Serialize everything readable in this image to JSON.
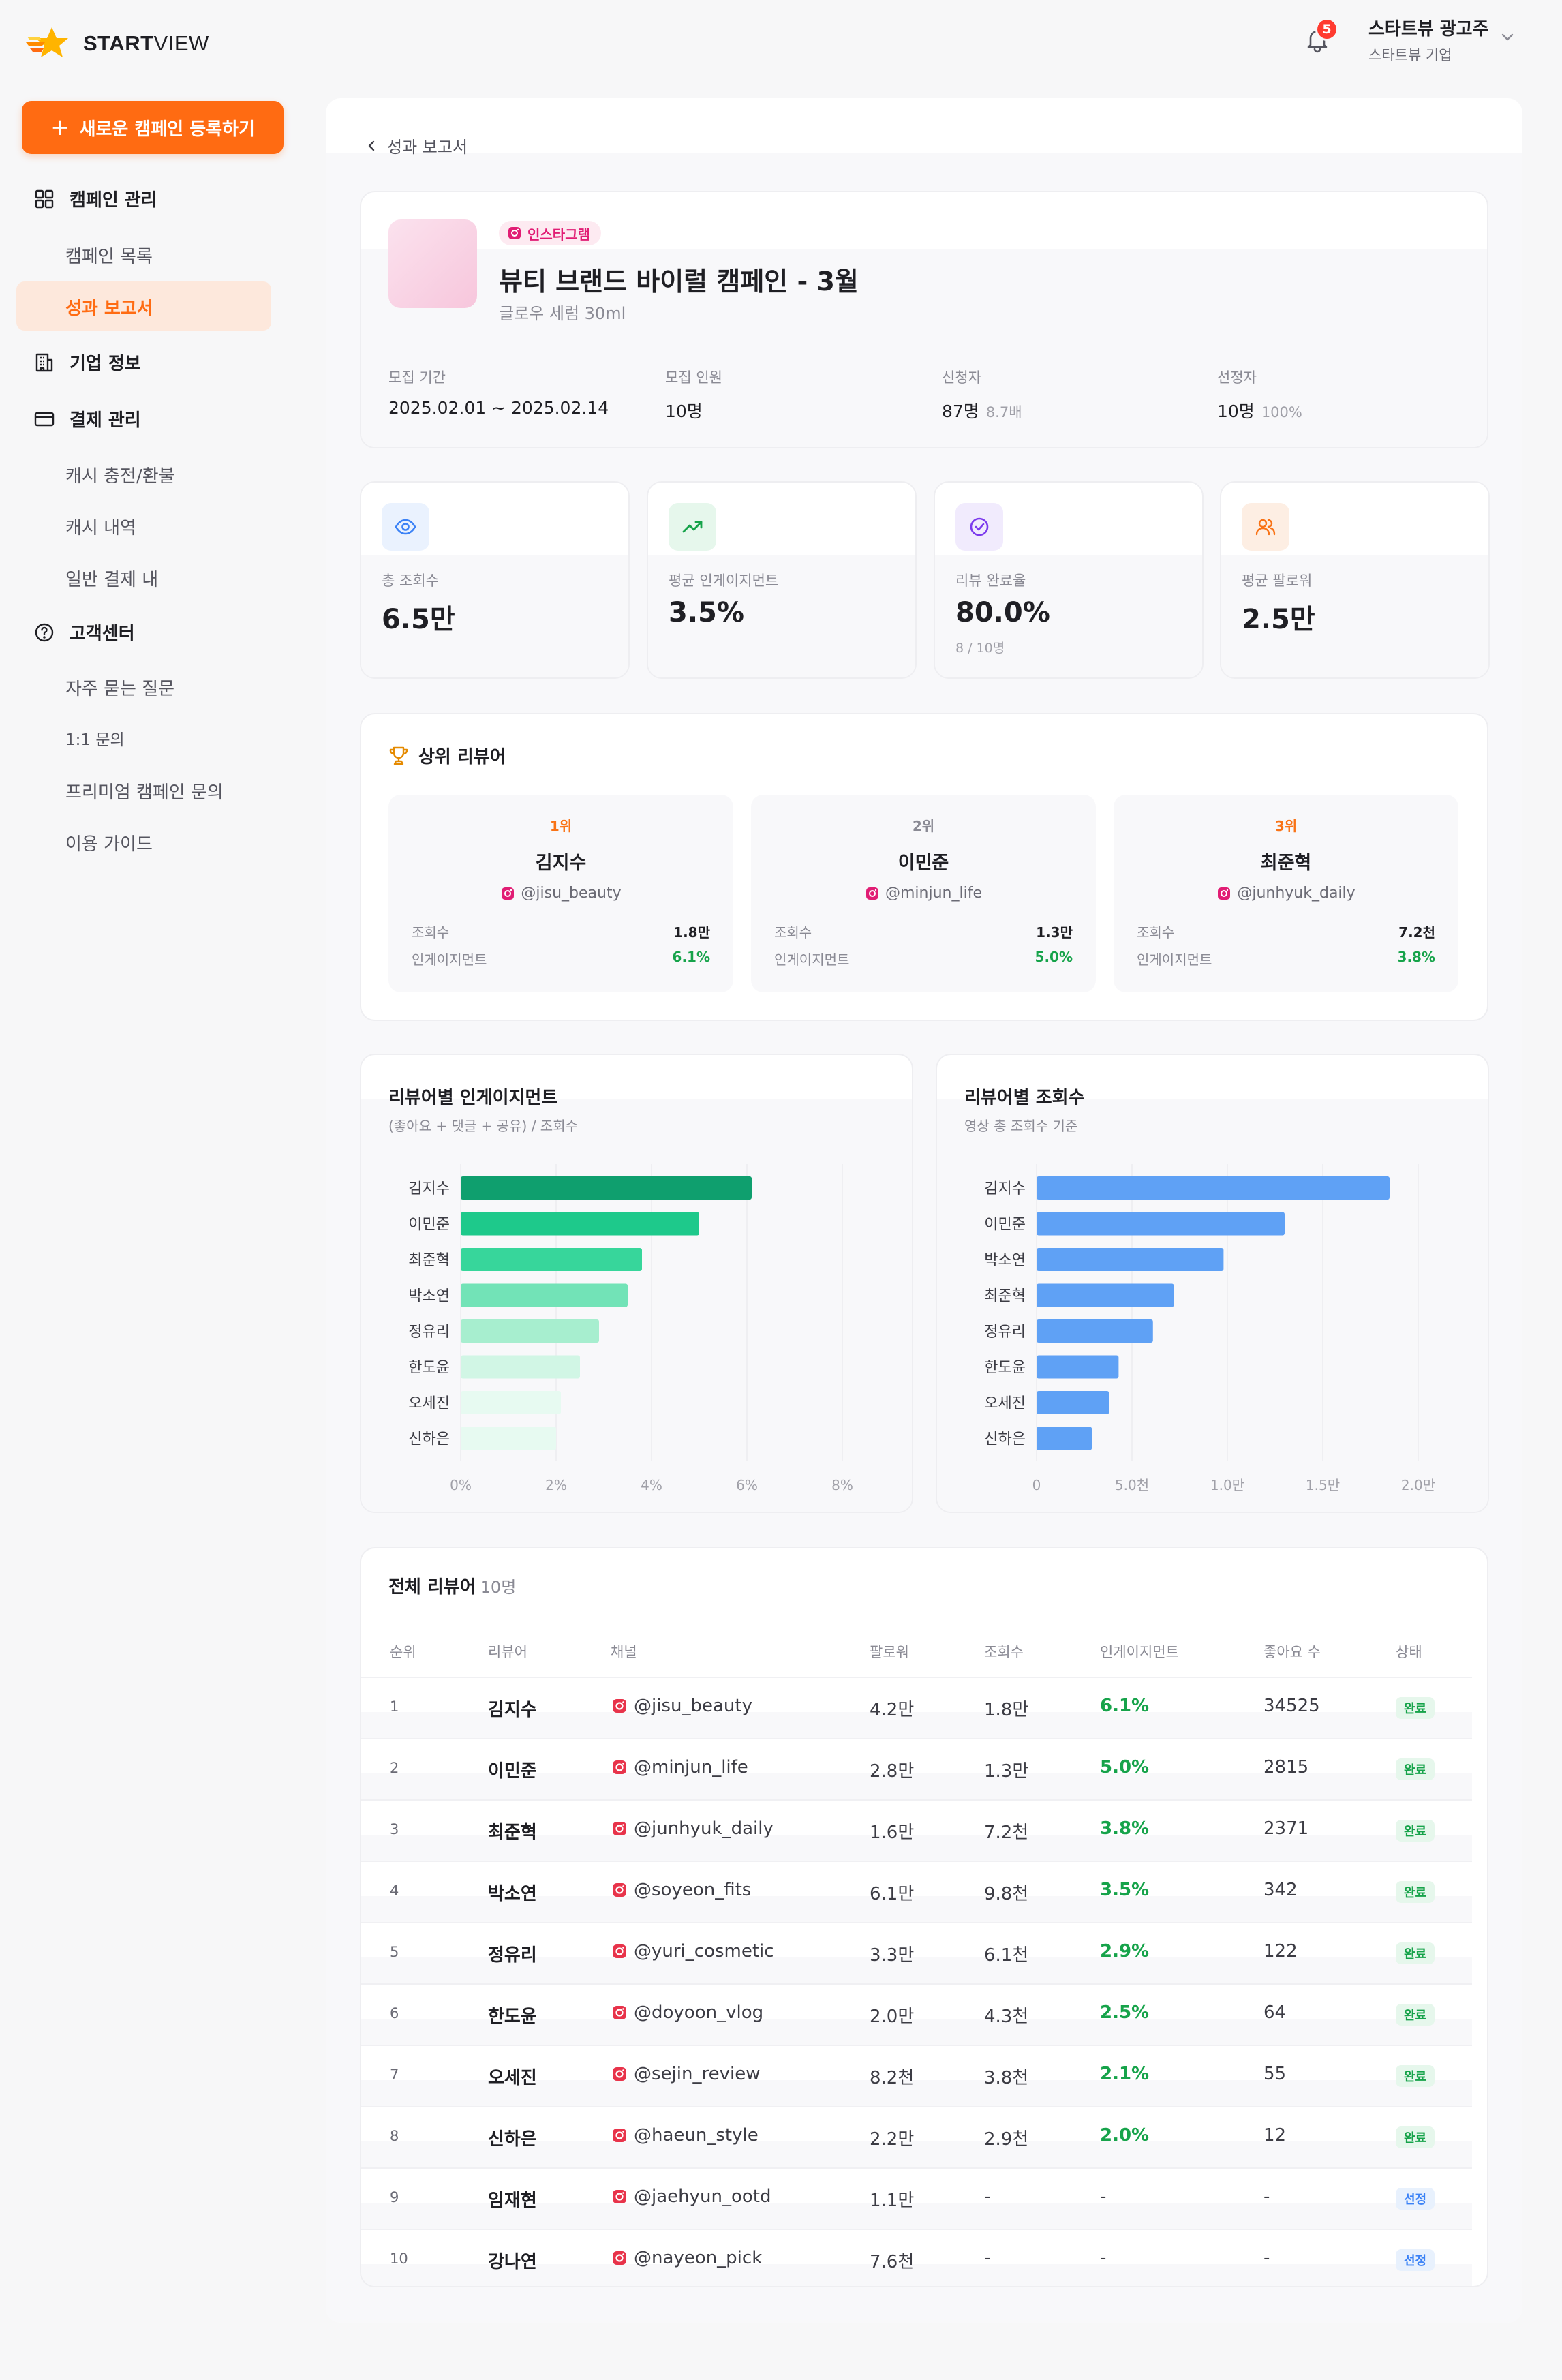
{
  "brand": {
    "name_bold": "START",
    "name_light": "VIEW"
  },
  "header": {
    "notification_count": "5",
    "user_name": "스타트뷰 광고주",
    "user_org": "스타트뷰 기업"
  },
  "sidebar": {
    "new_campaign_label": "새로운 캠페인 등록하기",
    "groups": [
      {
        "label": "캠페인 관리",
        "icon": "grid-icon",
        "items": [
          {
            "label": "캠페인 목록"
          },
          {
            "label": "성과 보고서",
            "active": true
          }
        ]
      },
      {
        "label": "기업 정보",
        "icon": "building-icon",
        "items": []
      },
      {
        "label": "결제 관리",
        "icon": "card-icon",
        "items": [
          {
            "label": "캐시 충전/환불"
          },
          {
            "label": "캐시 내역"
          },
          {
            "label": "일반 결제 내"
          }
        ]
      },
      {
        "label": "고객센터",
        "icon": "help-circle-icon",
        "items": [
          {
            "label": "자주 묻는 질문"
          },
          {
            "label": "1:1 문의"
          },
          {
            "label": "프리미엄 캠페인 문의"
          },
          {
            "label": "이용 가이드"
          }
        ]
      }
    ]
  },
  "breadcrumb": {
    "back_label": "성과 보고서"
  },
  "campaign": {
    "platform": "인스타그램",
    "title": "뷰티 브랜드 바이럴 캠페인 - 3월",
    "product": "글로우 세럼 30ml",
    "meta": [
      {
        "label": "모집 기간",
        "value": "2025.02.01 ~ 2025.02.14",
        "sub": ""
      },
      {
        "label": "모집 인원",
        "value": "10명",
        "sub": ""
      },
      {
        "label": "신청자",
        "value": "87명",
        "sub": "8.7배"
      },
      {
        "label": "선정자",
        "value": "10명",
        "sub": "100%"
      }
    ]
  },
  "stats": [
    {
      "label": "총 조회수",
      "value": "6.5만",
      "sub": "",
      "icon": "eye-icon",
      "color": "#3b82f6",
      "bg": "#eaf2fe"
    },
    {
      "label": "평균 인게이지먼트",
      "value": "3.5%",
      "sub": "",
      "icon": "trending-up-icon",
      "color": "#16a34a",
      "bg": "#e6f7ec"
    },
    {
      "label": "리뷰 완료율",
      "value": "80.0%",
      "sub": "8 / 10명",
      "icon": "check-circle-icon",
      "color": "#7c3aed",
      "bg": "#f1ebfd"
    },
    {
      "label": "평균 팔로워",
      "value": "2.5만",
      "sub": "",
      "icon": "users-icon",
      "color": "#f97316",
      "bg": "#fdeee3"
    }
  ],
  "top_reviewers": {
    "title": "상위 리뷰어",
    "views_label": "조회수",
    "engagement_label": "인게이지먼트",
    "items": [
      {
        "rank": "1위",
        "name": "김지수",
        "handle": "@jisu_beauty",
        "views": "1.8만",
        "engagement": "6.1%",
        "rank_color": "#f97316"
      },
      {
        "rank": "2위",
        "name": "이민준",
        "handle": "@minjun_life",
        "views": "1.3만",
        "engagement": "5.0%",
        "rank_color": "#8a8a94"
      },
      {
        "rank": "3위",
        "name": "최준혁",
        "handle": "@junhyuk_daily",
        "views": "7.2천",
        "engagement": "3.8%",
        "rank_color": "#f97316"
      }
    ]
  },
  "chart_data": [
    {
      "type": "bar",
      "orientation": "horizontal",
      "title": "리뷰어별 인게이지먼트",
      "subtitle": "(좋아요 + 댓글 + 공유) / 조회수",
      "categories": [
        "김지수",
        "이민준",
        "최준혁",
        "박소연",
        "정유리",
        "한도윤",
        "오세진",
        "신하은"
      ],
      "values": [
        6.1,
        5.0,
        3.8,
        3.5,
        2.9,
        2.5,
        2.1,
        2.0
      ],
      "colors": [
        "#0f9f6e",
        "#1ec98b",
        "#37d69b",
        "#72e3b7",
        "#a7eecf",
        "#d1f6e5",
        "#e7faf1",
        "#e7faf1"
      ],
      "xlim": [
        0,
        8
      ],
      "xticks": [
        "0%",
        "2%",
        "4%",
        "6%",
        "8%"
      ]
    },
    {
      "type": "bar",
      "orientation": "horizontal",
      "title": "리뷰어별 조회수",
      "subtitle": "영상 총 조회수 기준",
      "categories": [
        "김지수",
        "이민준",
        "박소연",
        "최준혁",
        "정유리",
        "한도윤",
        "오세진",
        "신하은"
      ],
      "values": [
        18500,
        13000,
        9800,
        7200,
        6100,
        4300,
        3800,
        2900
      ],
      "colors": [
        "#5fa1f5",
        "#5fa1f5",
        "#5fa1f5",
        "#5fa1f5",
        "#5fa1f5",
        "#5fa1f5",
        "#5fa1f5",
        "#5fa1f5"
      ],
      "xlim": [
        0,
        20000
      ],
      "xticks": [
        "0",
        "5.0천",
        "1.0만",
        "1.5만",
        "2.0만"
      ]
    }
  ],
  "table": {
    "title": "전체 리뷰어",
    "count": "10명",
    "headers": [
      "순위",
      "리뷰어",
      "채널",
      "팔로워",
      "조회수",
      "인게이지먼트",
      "좋아요 수",
      "상태"
    ],
    "rows": [
      {
        "rank": "1",
        "name": "김지수",
        "channel": "@jisu_beauty",
        "followers": "4.2만",
        "views": "1.8만",
        "engagement": "6.1%",
        "likes": "34525",
        "status": "완료"
      },
      {
        "rank": "2",
        "name": "이민준",
        "channel": "@minjun_life",
        "followers": "2.8만",
        "views": "1.3만",
        "engagement": "5.0%",
        "likes": "2815",
        "status": "완료"
      },
      {
        "rank": "3",
        "name": "최준혁",
        "channel": "@junhyuk_daily",
        "followers": "1.6만",
        "views": "7.2천",
        "engagement": "3.8%",
        "likes": "2371",
        "status": "완료"
      },
      {
        "rank": "4",
        "name": "박소연",
        "channel": "@soyeon_fits",
        "followers": "6.1만",
        "views": "9.8천",
        "engagement": "3.5%",
        "likes": "342",
        "status": "완료"
      },
      {
        "rank": "5",
        "name": "정유리",
        "channel": "@yuri_cosmetic",
        "followers": "3.3만",
        "views": "6.1천",
        "engagement": "2.9%",
        "likes": "122",
        "status": "완료"
      },
      {
        "rank": "6",
        "name": "한도윤",
        "channel": "@doyoon_vlog",
        "followers": "2.0만",
        "views": "4.3천",
        "engagement": "2.5%",
        "likes": "64",
        "status": "완료"
      },
      {
        "rank": "7",
        "name": "오세진",
        "channel": "@sejin_review",
        "followers": "8.2천",
        "views": "3.8천",
        "engagement": "2.1%",
        "likes": "55",
        "status": "완료"
      },
      {
        "rank": "8",
        "name": "신하은",
        "channel": "@haeun_style",
        "followers": "2.2만",
        "views": "2.9천",
        "engagement": "2.0%",
        "likes": "12",
        "status": "완료"
      },
      {
        "rank": "9",
        "name": "임재현",
        "channel": "@jaehyun_ootd",
        "followers": "1.1만",
        "views": "-",
        "engagement": "-",
        "likes": "-",
        "status": "선정"
      },
      {
        "rank": "10",
        "name": "강나연",
        "channel": "@nayeon_pick",
        "followers": "7.6천",
        "views": "-",
        "engagement": "-",
        "likes": "-",
        "status": "선정"
      }
    ]
  }
}
